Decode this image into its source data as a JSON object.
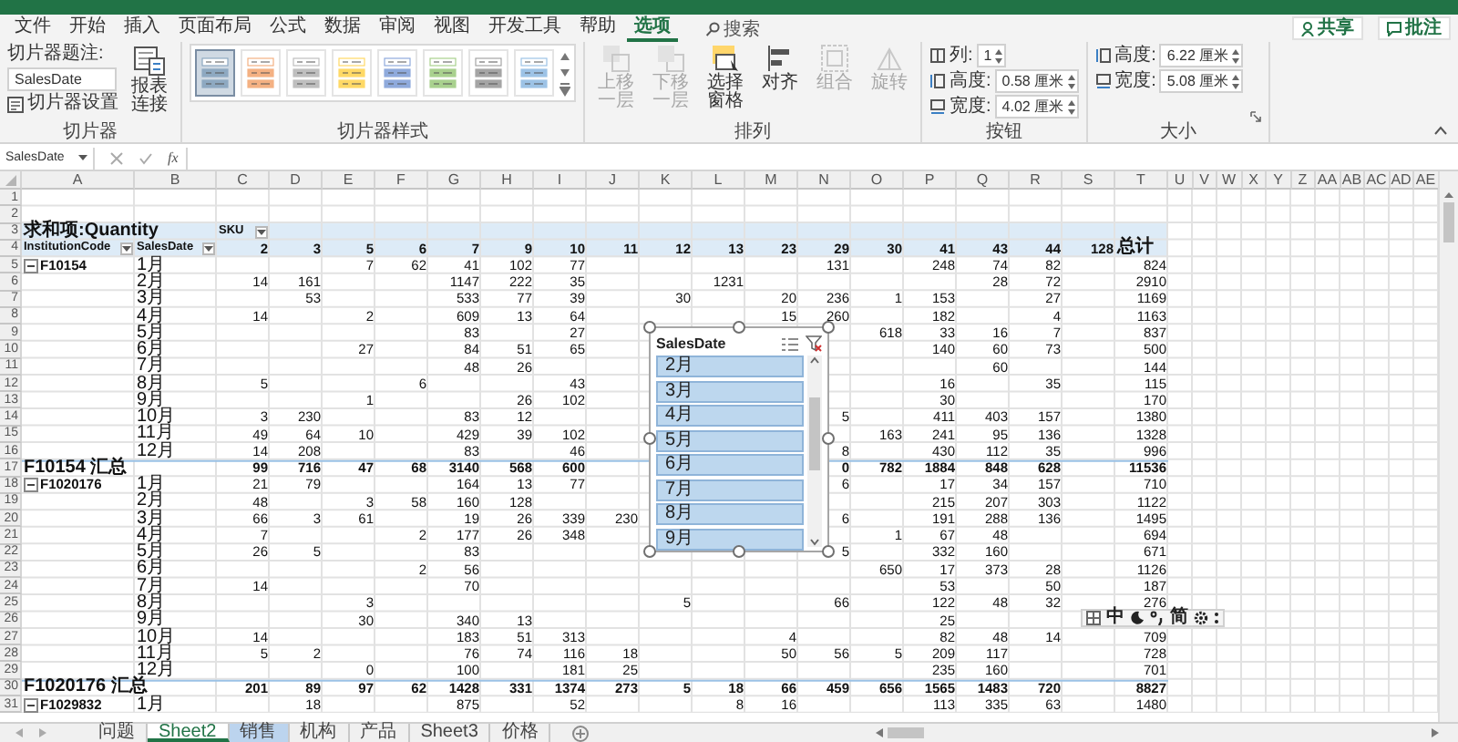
{
  "menu_tabs": [
    {
      "label": "文件",
      "selected": false
    },
    {
      "label": "开始",
      "selected": false
    },
    {
      "label": "插入",
      "selected": false
    },
    {
      "label": "页面布局",
      "selected": false
    },
    {
      "label": "公式",
      "selected": false
    },
    {
      "label": "数据",
      "selected": false
    },
    {
      "label": "审阅",
      "selected": false
    },
    {
      "label": "视图",
      "selected": false
    },
    {
      "label": "开发工具",
      "selected": false
    },
    {
      "label": "帮助",
      "selected": false
    },
    {
      "label": "选项",
      "selected": true
    }
  ],
  "search": {
    "placeholder": "搜索"
  },
  "share_button": "共享",
  "comments_button": "批注",
  "ribbon": {
    "slicer_group": {
      "caption_label": "切片器题注:",
      "caption_value": "SalesDate",
      "settings_button": "切片器设置",
      "report_connections_button": "报表连接",
      "label": "切片器"
    },
    "styles_group": {
      "label": "切片器样式",
      "styles": [
        {
          "color": "#8ea9c1",
          "selected": true
        },
        {
          "color": "#f4b183",
          "selected": false
        },
        {
          "color": "#bfbfbf",
          "selected": false
        },
        {
          "color": "#ffd966",
          "selected": false
        },
        {
          "color": "#8faadc",
          "selected": false
        },
        {
          "color": "#a9d18e",
          "selected": false
        },
        {
          "color": "#a5a5a5",
          "selected": false
        },
        {
          "color": "#9dc3e6",
          "selected": false
        }
      ]
    },
    "arrange_group": {
      "label": "排列",
      "buttons": [
        {
          "label": "上移一层",
          "disabled": true
        },
        {
          "label": "下移一层",
          "disabled": true
        },
        {
          "label": "选择窗格",
          "disabled": false
        },
        {
          "label": "对齐",
          "disabled": false
        },
        {
          "label": "组合",
          "disabled": true
        },
        {
          "label": "旋转",
          "disabled": true
        }
      ]
    },
    "buttons_group": {
      "label": "按钮",
      "fields": [
        {
          "label": "列:",
          "value": "1"
        },
        {
          "label": "高度:",
          "value": "0.58 厘米"
        },
        {
          "label": "宽度:",
          "value": "4.02 厘米"
        }
      ]
    },
    "size_group": {
      "label": "大小",
      "fields": [
        {
          "label": "高度:",
          "value": "6.22 厘米"
        },
        {
          "label": "宽度:",
          "value": "5.08 厘米"
        }
      ]
    }
  },
  "formula_bar": {
    "name_box": "SalesDate",
    "function_label": "fx"
  },
  "sheet": {
    "columns": [
      "A",
      "B",
      "C",
      "D",
      "E",
      "F",
      "G",
      "H",
      "I",
      "J",
      "K",
      "L",
      "M",
      "N",
      "O",
      "P",
      "Q",
      "R",
      "S",
      "T",
      "U",
      "V",
      "W",
      "X",
      "Y",
      "Z",
      "AA",
      "AB",
      "AC",
      "AD",
      "AE"
    ],
    "rows": [
      {
        "number": "1",
        "kind": "blank"
      },
      {
        "number": "2",
        "kind": "blank"
      },
      {
        "number": "3",
        "kind": "pivot_title",
        "cells": [
          "求和项:Quantity",
          null,
          {
            "text": "SKU",
            "dropdown": true
          }
        ]
      },
      {
        "number": "4",
        "kind": "pivot_header",
        "cells": [
          {
            "text": "InstitutionCode",
            "dropdown": true
          },
          {
            "text": "SalesDate",
            "dropdown": true
          },
          "2",
          "3",
          "5",
          "6",
          "7",
          "9",
          "10",
          "11",
          "12",
          "13",
          "23",
          "29",
          "30",
          "41",
          "43",
          "44",
          "128",
          "总计"
        ]
      },
      {
        "number": "5",
        "kind": "data",
        "expanded": true,
        "cells": [
          "F10154",
          "1月",
          null,
          null,
          "7",
          "62",
          "41",
          "102",
          "77",
          null,
          null,
          null,
          null,
          "131",
          null,
          "248",
          "74",
          "82",
          null,
          "824"
        ]
      },
      {
        "number": "6",
        "kind": "data",
        "cells": [
          null,
          "2月",
          "14",
          "161",
          null,
          null,
          "1147",
          "222",
          "35",
          null,
          null,
          "1231",
          null,
          null,
          null,
          null,
          "28",
          "72",
          null,
          "2910"
        ]
      },
      {
        "number": "7",
        "kind": "data",
        "cells": [
          null,
          "3月",
          null,
          "53",
          null,
          null,
          "533",
          "77",
          "39",
          null,
          "30",
          null,
          "20",
          "236",
          "1",
          "153",
          null,
          "27",
          null,
          "1169"
        ]
      },
      {
        "number": "8",
        "kind": "data",
        "cells": [
          null,
          "4月",
          "14",
          null,
          "2",
          null,
          "609",
          "13",
          "64",
          null,
          null,
          null,
          "15",
          "260",
          null,
          "182",
          null,
          "4",
          null,
          "1163"
        ]
      },
      {
        "number": "9",
        "kind": "data",
        "cells": [
          null,
          "5月",
          null,
          null,
          null,
          null,
          "83",
          null,
          "27",
          null,
          null,
          null,
          null,
          null,
          "618",
          "33",
          "16",
          "7",
          null,
          "837"
        ]
      },
      {
        "number": "10",
        "kind": "data",
        "cells": [
          null,
          "6月",
          null,
          null,
          "27",
          null,
          "84",
          "51",
          "65",
          null,
          null,
          null,
          null,
          null,
          null,
          "140",
          "60",
          "73",
          null,
          "500"
        ]
      },
      {
        "number": "11",
        "kind": "data",
        "cells": [
          null,
          "7月",
          null,
          null,
          null,
          null,
          "48",
          "26",
          null,
          null,
          null,
          null,
          null,
          null,
          null,
          null,
          "60",
          null,
          null,
          "144"
        ]
      },
      {
        "number": "12",
        "kind": "data",
        "cells": [
          null,
          "8月",
          "5",
          null,
          null,
          "6",
          null,
          null,
          "43",
          null,
          null,
          null,
          null,
          null,
          null,
          "16",
          null,
          "35",
          null,
          "115"
        ]
      },
      {
        "number": "13",
        "kind": "data",
        "cells": [
          null,
          "9月",
          null,
          null,
          "1",
          null,
          null,
          "26",
          "102",
          null,
          null,
          null,
          null,
          null,
          null,
          "30",
          null,
          null,
          null,
          "170"
        ]
      },
      {
        "number": "14",
        "kind": "data",
        "cells": [
          null,
          "10月",
          "3",
          "230",
          null,
          null,
          "83",
          "12",
          null,
          null,
          null,
          null,
          null,
          "5",
          null,
          "411",
          "403",
          "157",
          null,
          "1380"
        ]
      },
      {
        "number": "15",
        "kind": "data",
        "cells": [
          null,
          "11月",
          "49",
          "64",
          "10",
          null,
          "429",
          "39",
          "102",
          null,
          null,
          null,
          null,
          null,
          "163",
          "241",
          "95",
          "136",
          null,
          "1328"
        ]
      },
      {
        "number": "16",
        "kind": "data",
        "cells": [
          null,
          "12月",
          "14",
          "208",
          null,
          null,
          "83",
          null,
          "46",
          null,
          null,
          null,
          null,
          "8",
          null,
          "430",
          "112",
          "35",
          null,
          "996"
        ]
      },
      {
        "number": "17",
        "kind": "subtotal",
        "cells": [
          "F10154 汇总",
          null,
          "99",
          "716",
          "47",
          "68",
          "3140",
          "568",
          "600",
          null,
          null,
          null,
          null,
          "0",
          "782",
          "1884",
          "848",
          "628",
          null,
          "11536"
        ]
      },
      {
        "number": "18",
        "kind": "data",
        "expanded": true,
        "cells": [
          "F1020176",
          "1月",
          "21",
          "79",
          null,
          null,
          "164",
          "13",
          "77",
          null,
          null,
          null,
          null,
          "6",
          null,
          "17",
          "34",
          "157",
          null,
          "710"
        ]
      },
      {
        "number": "19",
        "kind": "data",
        "cells": [
          null,
          "2月",
          "48",
          null,
          "3",
          "58",
          "160",
          "128",
          null,
          null,
          null,
          null,
          null,
          null,
          null,
          "215",
          "207",
          "303",
          null,
          "1122"
        ]
      },
      {
        "number": "20",
        "kind": "data",
        "cells": [
          null,
          "3月",
          "66",
          "3",
          "61",
          null,
          "19",
          "26",
          "339",
          "230",
          null,
          null,
          null,
          "6",
          null,
          "191",
          "288",
          "136",
          null,
          "1495"
        ]
      },
      {
        "number": "21",
        "kind": "data",
        "cells": [
          null,
          "4月",
          "7",
          null,
          null,
          "2",
          "177",
          "26",
          "348",
          null,
          null,
          null,
          null,
          null,
          "1",
          "67",
          "48",
          null,
          null,
          "694"
        ]
      },
      {
        "number": "22",
        "kind": "data",
        "cells": [
          null,
          "5月",
          "26",
          "5",
          null,
          null,
          "83",
          null,
          null,
          null,
          null,
          null,
          null,
          "5",
          null,
          "332",
          "160",
          null,
          null,
          "671"
        ]
      },
      {
        "number": "23",
        "kind": "data",
        "cells": [
          null,
          "6月",
          null,
          null,
          null,
          "2",
          "56",
          null,
          null,
          null,
          null,
          null,
          null,
          null,
          "650",
          "17",
          "373",
          "28",
          null,
          "1126"
        ]
      },
      {
        "number": "24",
        "kind": "data",
        "cells": [
          null,
          "7月",
          "14",
          null,
          null,
          null,
          "70",
          null,
          null,
          null,
          null,
          null,
          null,
          null,
          null,
          "53",
          null,
          "50",
          null,
          "187"
        ]
      },
      {
        "number": "25",
        "kind": "data",
        "cells": [
          null,
          "8月",
          null,
          null,
          "3",
          null,
          null,
          null,
          null,
          null,
          "5",
          null,
          null,
          "66",
          null,
          "122",
          "48",
          "32",
          null,
          "276"
        ]
      },
      {
        "number": "26",
        "kind": "data",
        "cells": [
          null,
          "9月",
          null,
          null,
          "30",
          null,
          "340",
          "13",
          null,
          null,
          null,
          null,
          null,
          null,
          null,
          "25"
        ]
      },
      {
        "number": "27",
        "kind": "data",
        "cells": [
          null,
          "10月",
          "14",
          null,
          null,
          null,
          "183",
          "51",
          "313",
          null,
          null,
          null,
          "4",
          null,
          null,
          "82",
          "48",
          "14",
          null,
          "709"
        ]
      },
      {
        "number": "28",
        "kind": "data",
        "cells": [
          null,
          "11月",
          "5",
          "2",
          null,
          null,
          "76",
          "74",
          "116",
          "18",
          null,
          null,
          "50",
          "56",
          "5",
          "209",
          "117",
          null,
          null,
          "728"
        ]
      },
      {
        "number": "29",
        "kind": "data",
        "cells": [
          null,
          "12月",
          null,
          null,
          "0",
          null,
          "100",
          null,
          "181",
          "25",
          null,
          null,
          null,
          null,
          null,
          "235",
          "160",
          null,
          null,
          "701"
        ]
      },
      {
        "number": "30",
        "kind": "subtotal",
        "cells": [
          "F1020176 汇总",
          null,
          "201",
          "89",
          "97",
          "62",
          "1428",
          "331",
          "1374",
          "273",
          "5",
          "18",
          "66",
          "459",
          "656",
          "1565",
          "1483",
          "720",
          null,
          "8827"
        ]
      },
      {
        "number": "31",
        "kind": "data",
        "expanded": true,
        "cells": [
          "F1029832",
          "1月",
          null,
          "18",
          null,
          null,
          "875",
          null,
          "52",
          null,
          null,
          "8",
          "16",
          null,
          null,
          "113",
          "335",
          "63",
          null,
          "1480"
        ]
      }
    ]
  },
  "slicer": {
    "title": "SalesDate",
    "items": [
      {
        "label": "2月",
        "selected": true
      },
      {
        "label": "3月",
        "selected": true
      },
      {
        "label": "4月",
        "selected": true
      },
      {
        "label": "5月",
        "selected": true
      },
      {
        "label": "6月",
        "selected": true
      },
      {
        "label": "7月",
        "selected": true
      },
      {
        "label": "8月",
        "selected": true
      },
      {
        "label": "9月",
        "selected": true
      }
    ]
  },
  "ime_toolbar": {
    "mode": "中",
    "script": "简"
  },
  "sheet_tabs": [
    {
      "label": "问题",
      "selected": false,
      "highlighted": false
    },
    {
      "label": "Sheet2",
      "selected": true,
      "highlighted": false
    },
    {
      "label": "销售",
      "selected": false,
      "highlighted": true
    },
    {
      "label": "机构",
      "selected": false,
      "highlighted": false
    },
    {
      "label": "产品",
      "selected": false,
      "highlighted": false
    },
    {
      "label": "Sheet3",
      "selected": false,
      "highlighted": false
    },
    {
      "label": "价格",
      "selected": false,
      "highlighted": false
    }
  ]
}
